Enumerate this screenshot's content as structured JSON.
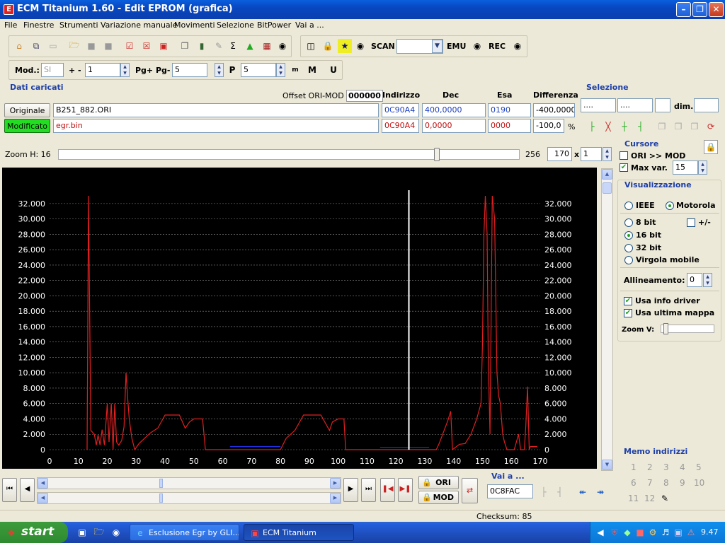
{
  "window": {
    "title": "ECM Titanium 1.60 - Edit EPROM (grafica)"
  },
  "menu": [
    "File",
    "Finestre",
    "Strumenti",
    "Variazione manuale",
    "Movimenti",
    "Selezione",
    "BitPower",
    "Vai a ..."
  ],
  "toolbar1": {
    "scan": "SCAN",
    "emu": "EMU",
    "rec": "REC"
  },
  "toolbar2": {
    "mod_label": "Mod.:",
    "mod_value": "SI",
    "plusminus": "+ -",
    "step": "1",
    "pg_label": "Pg+ Pg-",
    "pg_value": "5",
    "p_value": "5"
  },
  "dati": {
    "title": "Dati caricati",
    "offset_label": "Offset ORI-MOD",
    "offset_value": "000000",
    "headers": {
      "indirizzo": "Indirizzo",
      "dec": "Dec",
      "esa": "Esa",
      "diff": "Differenza"
    },
    "originale": {
      "label": "Originale",
      "file": "B251_882.ORI",
      "addr": "0C90A4",
      "dec": "400,0000",
      "esa": "0190",
      "diff": "-400,0000"
    },
    "modificato": {
      "label": "Modificato",
      "file": "egr.bin",
      "addr": "0C90A4",
      "dec": "0,0000",
      "esa": "0000",
      "diff": "-100,0",
      "pct": "%"
    }
  },
  "selezione": {
    "title": "Selezione",
    "f1": "....",
    "f2": "....",
    "dim_label": "dim."
  },
  "zoom": {
    "label": "Zoom H: 16",
    "max": "256",
    "value": "170",
    "times": "x",
    "mult": "1",
    "zoom_h_level": 0.82
  },
  "cursore": {
    "title": "Cursore",
    "ori_mod": "ORI >> MOD",
    "max_var": "Max var.",
    "max_var_value": "15"
  },
  "visual": {
    "title": "Visualizzazione",
    "ieee": "IEEE",
    "motorola": "Motorola",
    "b8": "8 bit",
    "pm": "+/-",
    "b16": "16 bit",
    "b32": "32 bit",
    "vm": "Virgola mobile",
    "allin_label": "Allineamento:",
    "allin_value": "0",
    "usa_info": "Usa info driver",
    "usa_ultima": "Usa ultima mappa",
    "zoomv_label": "Zoom V:"
  },
  "memo": {
    "title": "Memo indirizzi",
    "nums": [
      "1",
      "2",
      "3",
      "4",
      "5",
      "6",
      "7",
      "8",
      "9",
      "10",
      "11",
      "12"
    ]
  },
  "bottom": {
    "ori": "ORI",
    "mod": "MOD",
    "vai_label": "Vai a ...",
    "vai_value": "0C8FAC",
    "checksum": "Checksum: 85"
  },
  "taskbar": {
    "start": "start",
    "t1": "Esclusione Egr by GLI...",
    "t2": "ECM Titanium",
    "time": "9.47"
  },
  "colors": {
    "chart_bg": "#000000",
    "ori_line": "#e02020",
    "mod_line": "#2030e0",
    "cursor": "#ffffff"
  },
  "chart_data": {
    "type": "line",
    "xlim": [
      0,
      170
    ],
    "ylim": [
      0,
      33000
    ],
    "xticks": [
      0,
      10,
      20,
      30,
      40,
      50,
      60,
      70,
      80,
      90,
      100,
      110,
      120,
      130,
      140,
      150,
      160,
      170
    ],
    "yticks": [
      "0",
      "2.000",
      "4.000",
      "6.000",
      "8.000",
      "10.000",
      "12.000",
      "14.000",
      "16.000",
      "18.000",
      "20.000",
      "22.000",
      "24.000",
      "26.000",
      "28.000",
      "30.000",
      "32.000"
    ],
    "grid": true,
    "cursor_x": 124.5,
    "series": [
      {
        "values_xy": [
          [
            13,
            0
          ],
          [
            13.5,
            33000
          ],
          [
            14.3,
            2500
          ],
          [
            15.5,
            2000
          ],
          [
            16.2,
            600
          ],
          [
            16.8,
            1900
          ],
          [
            17.5,
            600
          ],
          [
            18.2,
            2600
          ],
          [
            19,
            600
          ],
          [
            20,
            6000
          ],
          [
            20.6,
            1000
          ],
          [
            21.4,
            6000
          ],
          [
            22,
            0
          ],
          [
            22.6,
            6000
          ],
          [
            23.2,
            1000
          ],
          [
            24,
            600
          ],
          [
            25,
            1200
          ],
          [
            25.8,
            3000
          ],
          [
            26.5,
            10000
          ],
          [
            27,
            7000
          ],
          [
            27.6,
            4000
          ],
          [
            28.5,
            1500
          ],
          [
            29.5,
            0
          ],
          [
            31,
            800
          ],
          [
            33,
            1500
          ],
          [
            35,
            2200
          ],
          [
            37.5,
            2800
          ],
          [
            40,
            4500
          ],
          [
            45,
            4500
          ],
          [
            47,
            2800
          ],
          [
            48.5,
            3600
          ],
          [
            50,
            4000
          ],
          [
            53,
            4000
          ],
          [
            54,
            0
          ],
          [
            80,
            0
          ],
          [
            82,
            1500
          ],
          [
            85,
            2500
          ],
          [
            88,
            4500
          ],
          [
            94,
            4500
          ],
          [
            97,
            2500
          ],
          [
            98,
            3600
          ],
          [
            100,
            4000
          ],
          [
            102,
            4000
          ],
          [
            102.6,
            0
          ],
          [
            134,
            0
          ],
          [
            135,
            800
          ],
          [
            138,
            3800
          ],
          [
            139,
            5000
          ],
          [
            139.6,
            0
          ],
          [
            142,
            700
          ],
          [
            144,
            800
          ],
          [
            146,
            2000
          ],
          [
            148,
            4000
          ],
          [
            149.5,
            6000
          ],
          [
            150,
            14000
          ],
          [
            150.5,
            28000
          ],
          [
            151,
            33000
          ],
          [
            151.6,
            28000
          ],
          [
            152,
            12000
          ],
          [
            152.6,
            2000
          ],
          [
            153.4,
            33000
          ],
          [
            154.2,
            30000
          ],
          [
            155,
            10000
          ],
          [
            155.6,
            7000
          ],
          [
            156.2,
            6000
          ],
          [
            157,
            2000
          ],
          [
            157.6,
            1000
          ],
          [
            158.5,
            0
          ],
          [
            161,
            0
          ],
          [
            162.5,
            2000
          ],
          [
            163.2,
            0
          ],
          [
            164.5,
            0
          ],
          [
            165,
            3000
          ],
          [
            165.6,
            8200
          ],
          [
            166.2,
            0
          ],
          [
            166.6,
            400
          ],
          [
            169,
            400
          ]
        ]
      },
      {
        "values_xy": [
          [
            62.5,
            400
          ],
          [
            80,
            400
          ]
        ]
      },
      {
        "values_xy": [
          [
            114.5,
            300
          ],
          [
            131.5,
            300
          ]
        ]
      }
    ]
  }
}
